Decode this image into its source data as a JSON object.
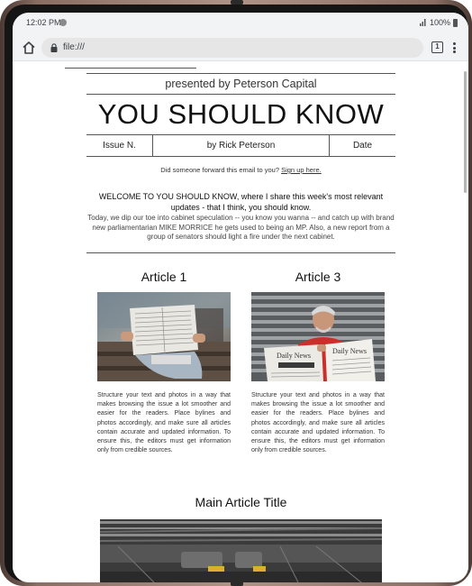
{
  "status_bar": {
    "time": "12:02 PM",
    "battery": "100%"
  },
  "browser": {
    "url": "file:///",
    "tab_count": "1"
  },
  "newsletter": {
    "presented_by": "presented by Peterson Capital",
    "headline": "YOU SHOULD KNOW",
    "issue": "Issue N.",
    "author": "by Rick Peterson",
    "date": "Date",
    "forward_text": "Did someone forward this email to you?",
    "signup_link": "Sign up here.",
    "welcome": "WELCOME TO YOU SHOULD KNOW, where I share this week's most relevant updates - that I think, you should know.",
    "intro": "Today, we dip our toe into cabinet speculation -- you know you wanna -- and catch up with brand new parliamentarian MIKE MORRICE he gets used to being an MP. Also, a new report from a group of senators should light a fire under the next cabinet.",
    "articles": [
      {
        "title": "Article 1",
        "body": "Structure your text and photos in a way that makes browsing the issue a lot smoother and easier for the readers. Place bylines and photos accordingly, and make sure all articles contain accurate and updated information. To ensure this, the editors must get information only from credible sources."
      },
      {
        "title": "Article 3",
        "body": "Structure your text and photos in a way that makes browsing the issue a lot smoother and easier for the readers. Place bylines and photos accordingly, and make sure all articles contain accurate and updated information. To ensure this, the editors must get information only from credible sources.",
        "paper_headline": "Daily News"
      }
    ],
    "main_article_title": "Main Article Title"
  }
}
